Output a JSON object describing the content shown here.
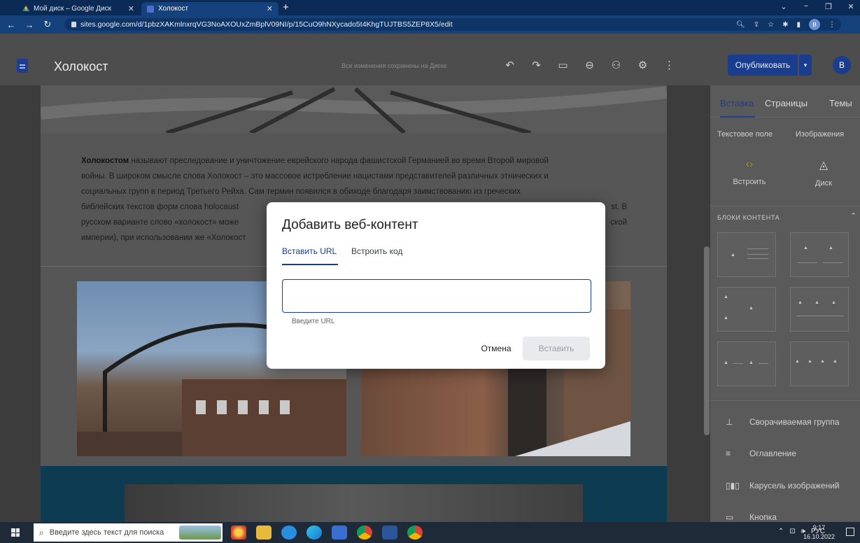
{
  "browser": {
    "tabs": [
      {
        "title": "Мой диск – Google Диск",
        "active": false
      },
      {
        "title": "Холокост",
        "active": true
      }
    ],
    "new_tab_label": "+",
    "url": "sites.google.com/d/1pbzXAKmlnxrqVG3NoAXOUxZmBplV09NI/p/15CuO9hNXycado5t4KhgTUJTBS5ZEP8X5/edit",
    "profile_letter": "B",
    "colors": {
      "chrome": "#0b2a55",
      "toolbar": "#15417c"
    }
  },
  "sites": {
    "title": "Холокост",
    "save_status": "Все изменения сохранены на Диске",
    "publish_label": "Опубликовать",
    "avatar_letter": "B",
    "accent": "#1a3d8f"
  },
  "content": {
    "paragraph_bold": "Холокостом",
    "paragraph_line1": " называют преследование и уничтожение еврейского народа фашистской Германией во время Второй мировой",
    "paragraph_line2": "войны. В широком смысле слова Холокост – это массовое истребление нацистами представителей различных этнических и",
    "paragraph_line3": "социальных групп в период Третьего Рейха. Сам термин появился в обиходе благодаря заимствованию из греческих",
    "paragraph_line4": "библейских текстов форм слова holocaust",
    "paragraph_line4_end": "st. В",
    "paragraph_line5": "русском варианте слово «холокост» може",
    "paragraph_line5_end": "ской",
    "paragraph_line6": "империи), при использовании же «Холокост"
  },
  "panel": {
    "tabs": [
      "Вставка",
      "Страницы",
      "Темы"
    ],
    "subtabs": [
      "Текстовое поле",
      "Изображения"
    ],
    "tools": [
      {
        "label": "Встроить",
        "icon": "embed-code-icon"
      },
      {
        "label": "Диск",
        "icon": "drive-icon"
      }
    ],
    "blocks_title": "БЛОКИ КОНТЕНТА",
    "list": [
      {
        "label": "Сворачиваемая группа",
        "icon": "collapsible-group-icon"
      },
      {
        "label": "Оглавление",
        "icon": "table-of-contents-icon"
      },
      {
        "label": "Карусель изображений",
        "icon": "image-carousel-icon"
      },
      {
        "label": "Кнопка",
        "icon": "button-icon"
      }
    ]
  },
  "dialog": {
    "title": "Добавить веб-контент",
    "tab_url": "Вставить URL",
    "tab_code": "Встроить код",
    "input_value": "",
    "input_hint": "Введите URL",
    "cancel_label": "Отмена",
    "insert_label": "Вставить"
  },
  "taskbar": {
    "search_placeholder": "Введите здесь текст для поиска",
    "language": "РУС",
    "time": "9:17",
    "date": "16.10.2022"
  }
}
